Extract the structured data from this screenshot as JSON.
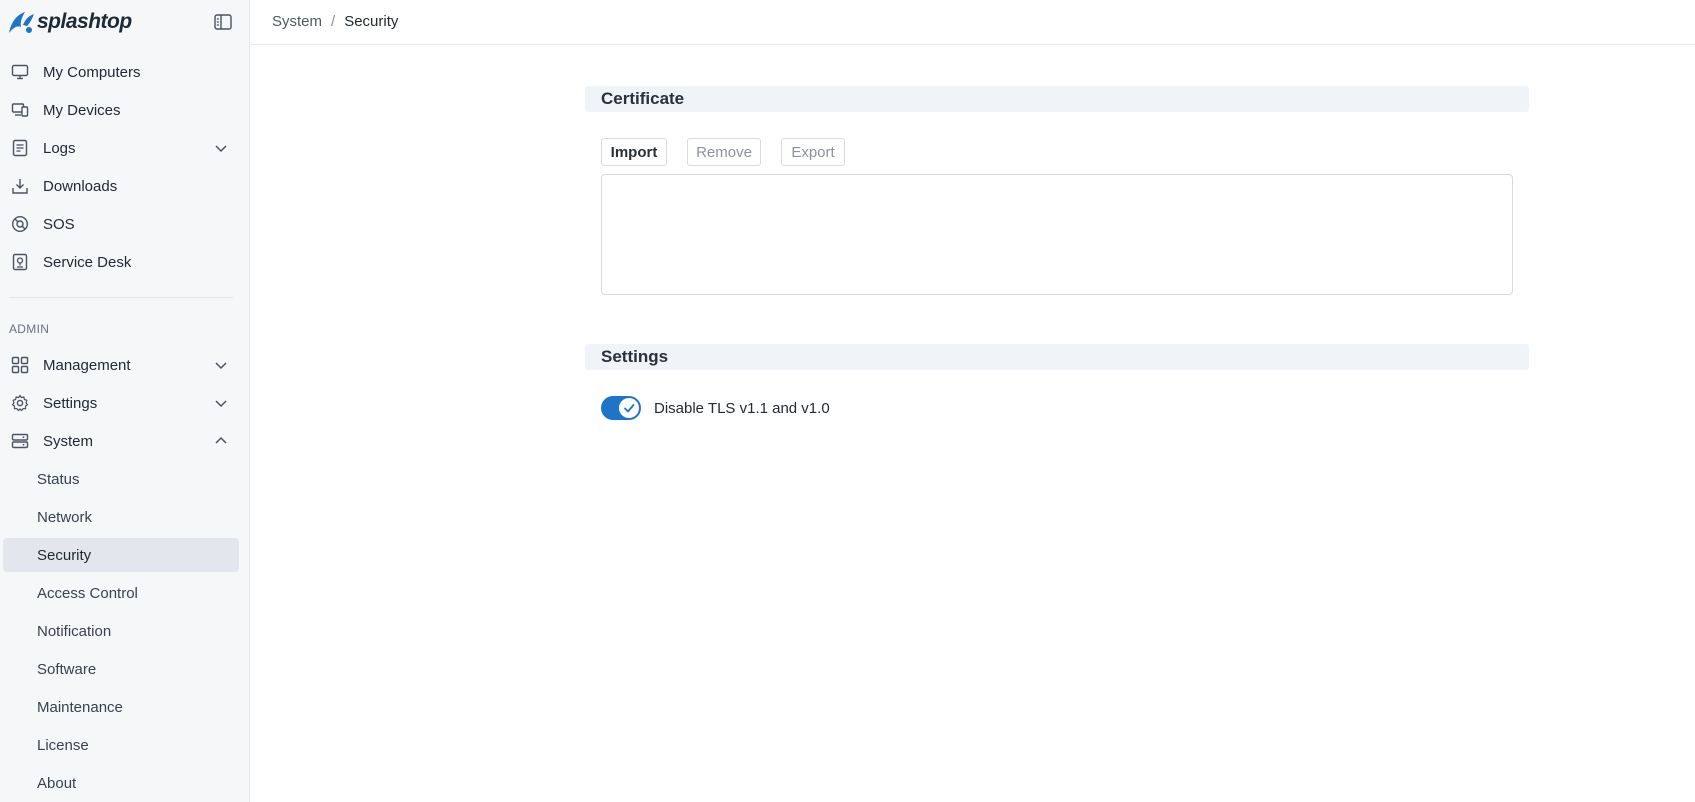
{
  "brand": {
    "logo_text": "splashtop",
    "logo_icon": "splashtop-logo-icon",
    "collapse_icon": "sidebar-collapse-icon",
    "color": "#1f74c7"
  },
  "sidebar": {
    "main_items": [
      {
        "label": "My Computers",
        "icon": "monitor-icon"
      },
      {
        "label": "My Devices",
        "icon": "devices-icon"
      },
      {
        "label": "Logs",
        "icon": "logs-icon",
        "expandable": true,
        "expanded": false
      },
      {
        "label": "Downloads",
        "icon": "download-icon"
      },
      {
        "label": "SOS",
        "icon": "sos-icon"
      },
      {
        "label": "Service Desk",
        "icon": "service-desk-icon"
      }
    ],
    "admin_label": "ADMIN",
    "admin_items": [
      {
        "label": "Management",
        "icon": "grid-icon",
        "expandable": true,
        "expanded": false
      },
      {
        "label": "Settings",
        "icon": "gear-icon",
        "expandable": true,
        "expanded": false
      },
      {
        "label": "System",
        "icon": "server-icon",
        "expandable": true,
        "expanded": true
      }
    ],
    "system_subitems": [
      {
        "label": "Status"
      },
      {
        "label": "Network"
      },
      {
        "label": "Security",
        "active": true
      },
      {
        "label": "Access Control"
      },
      {
        "label": "Notification"
      },
      {
        "label": "Software"
      },
      {
        "label": "Maintenance"
      },
      {
        "label": "License"
      },
      {
        "label": "About"
      }
    ]
  },
  "breadcrumb": {
    "parent": "System",
    "separator": "/",
    "current": "Security"
  },
  "certificate": {
    "title": "Certificate",
    "buttons": {
      "import": {
        "label": "Import",
        "enabled": true
      },
      "remove": {
        "label": "Remove",
        "enabled": false
      },
      "export": {
        "label": "Export",
        "enabled": false
      }
    },
    "content": ""
  },
  "settings": {
    "title": "Settings",
    "tls_toggle": {
      "label": "Disable TLS v1.1 and v1.0",
      "checked": true
    }
  },
  "colors": {
    "accent": "#1f74c7",
    "sidebar_bg": "#f6f7f9",
    "active_item_bg": "#e3e7ed",
    "section_header_bg": "#f0f3f7"
  }
}
